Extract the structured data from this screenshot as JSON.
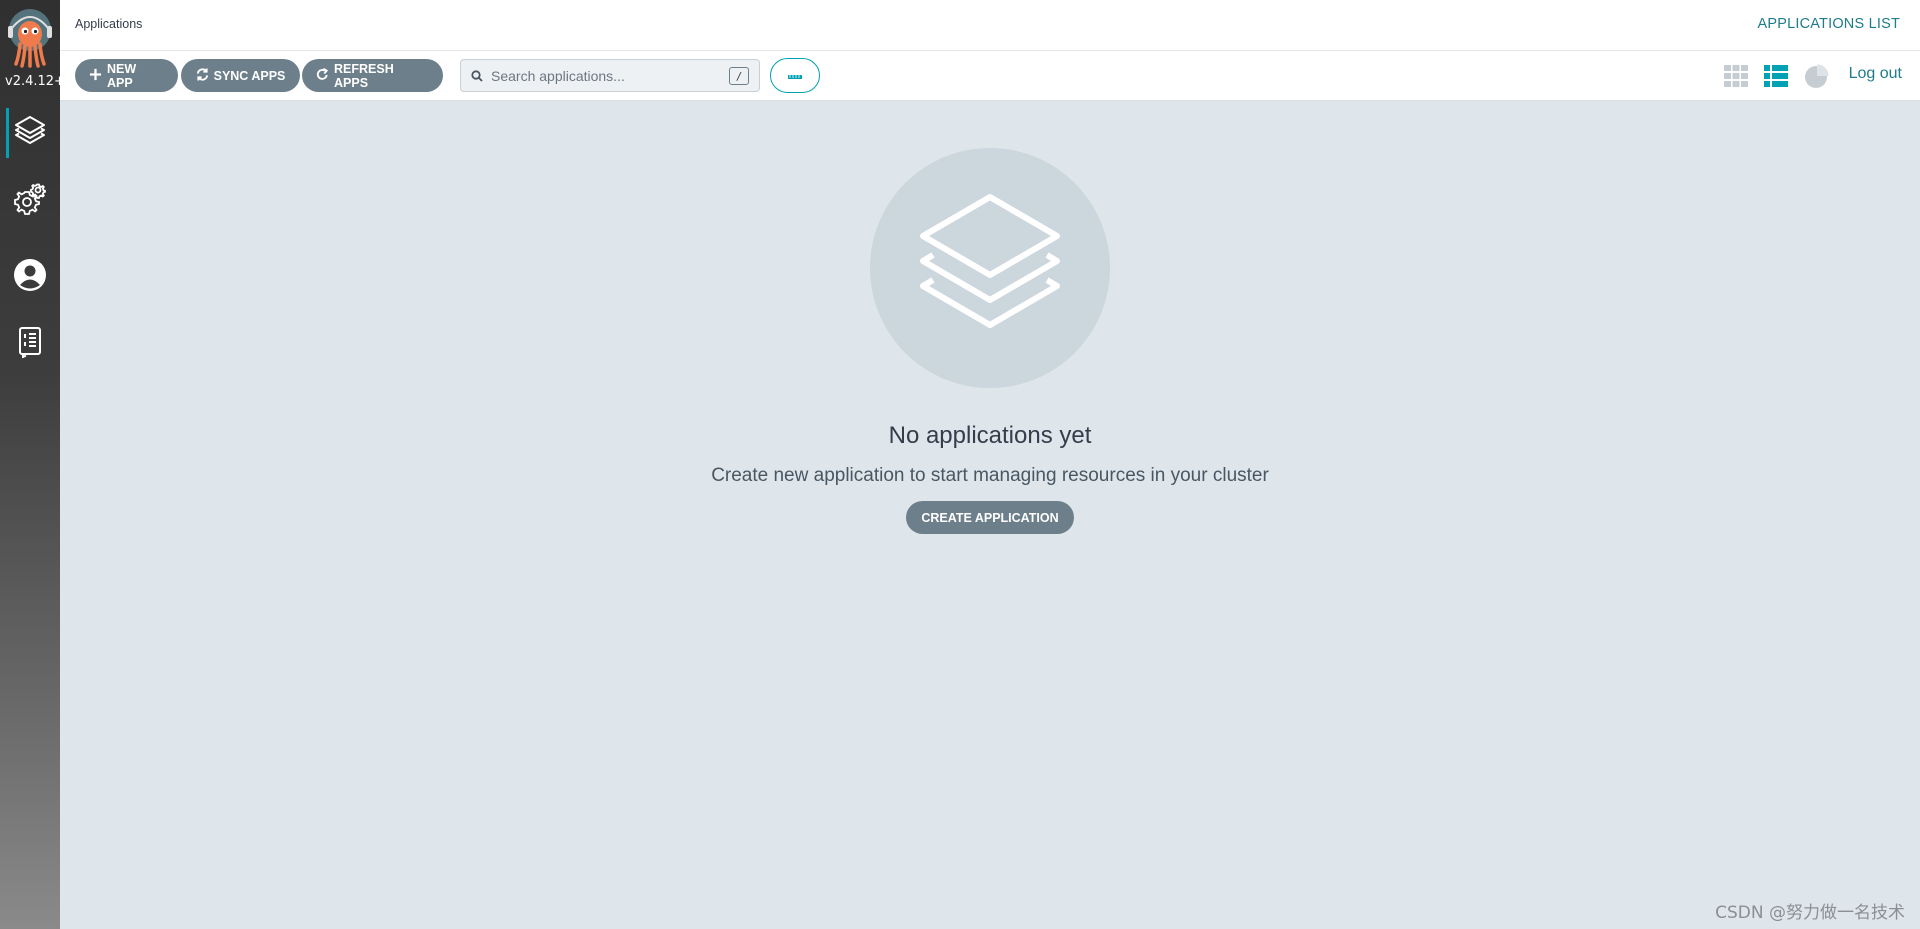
{
  "sidebar": {
    "version": "v2.4.12+",
    "items": [
      {
        "name": "applications",
        "icon": "layers-icon"
      },
      {
        "name": "settings",
        "icon": "gear-icon"
      },
      {
        "name": "user-info",
        "icon": "user-icon"
      },
      {
        "name": "documentation",
        "icon": "docs-icon"
      }
    ]
  },
  "header": {
    "breadcrumb": "Applications",
    "page_title": "APPLICATIONS LIST"
  },
  "toolbar": {
    "new_app_label": "NEW APP",
    "sync_apps_label": "SYNC APPS",
    "refresh_apps_label": "REFRESH APPS",
    "search_placeholder": "Search applications...",
    "search_shortcut": "/",
    "logout_label": "Log out",
    "views": [
      "tiles-view-icon",
      "list-view-icon",
      "summary-pie-icon"
    ],
    "active_view": "list-view-icon"
  },
  "empty_state": {
    "title": "No applications yet",
    "subtitle": "Create new application to start managing resources in your cluster",
    "create_label": "CREATE APPLICATION"
  },
  "watermark": "CSDN @努力做一名技术",
  "colors": {
    "accent": "#00a2b3",
    "link": "#1f7c8a",
    "button": "#6d7f8b",
    "background": "#dee6eb"
  }
}
